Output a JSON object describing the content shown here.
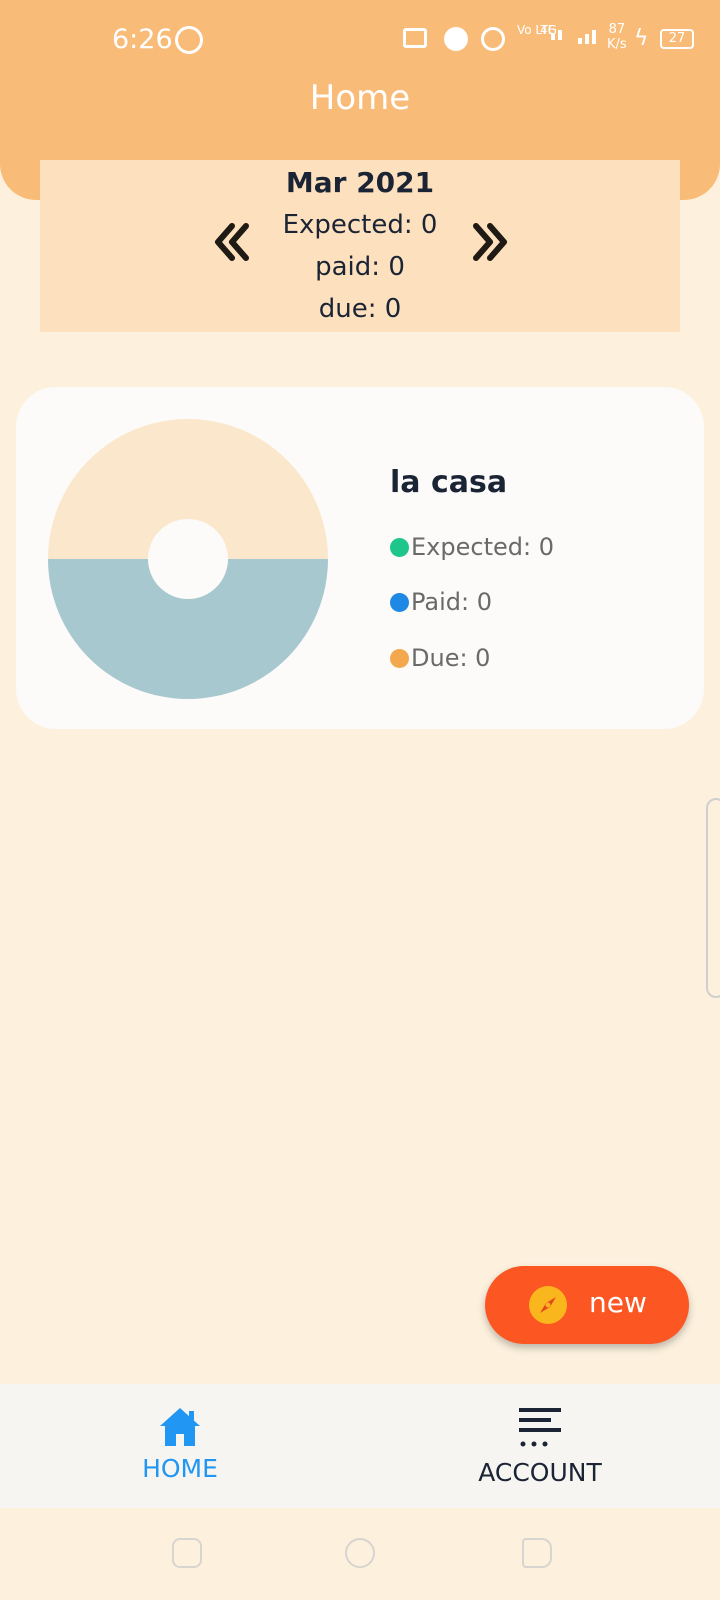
{
  "status_bar": {
    "time": "6:26",
    "network_type": "Vo LTE",
    "network_gen": "4G",
    "speed_value": "87",
    "speed_unit": "K/s",
    "battery": "27",
    "icons": [
      "whatsapp-icon",
      "cast-icon",
      "alarm-icon",
      "hotspot-icon",
      "signal-icon",
      "charging-icon",
      "battery-icon"
    ]
  },
  "header": {
    "title": "Home"
  },
  "month_summary": {
    "month": "Mar 2021",
    "expected_line": "Expected: 0",
    "paid_line": "paid: 0",
    "due_line": "due: 0",
    "prev_icon": "chevron-double-left-icon",
    "next_icon": "chevron-double-right-icon"
  },
  "property_card": {
    "name": "la casa",
    "legend": [
      {
        "label": "Expected: 0",
        "color": "#1ec68c"
      },
      {
        "label": "Paid: 0",
        "color": "#1e88e5"
      },
      {
        "label": "Due: 0",
        "color": "#f4a84d"
      }
    ],
    "donut_colors": {
      "top": "#fbe8cc",
      "bottom": "#a8c8cf"
    }
  },
  "fab": {
    "label": "new",
    "icon": "compass-icon"
  },
  "bottom_nav": {
    "items": [
      {
        "label": "HOME",
        "icon": "home-icon",
        "active": true
      },
      {
        "label": "ACCOUNT",
        "icon": "menu-list-icon",
        "active": false
      }
    ]
  },
  "colors": {
    "header": "#f9bb78",
    "background": "#fdf1de",
    "fab": "#fc5622",
    "active_nav": "#2196f3"
  }
}
